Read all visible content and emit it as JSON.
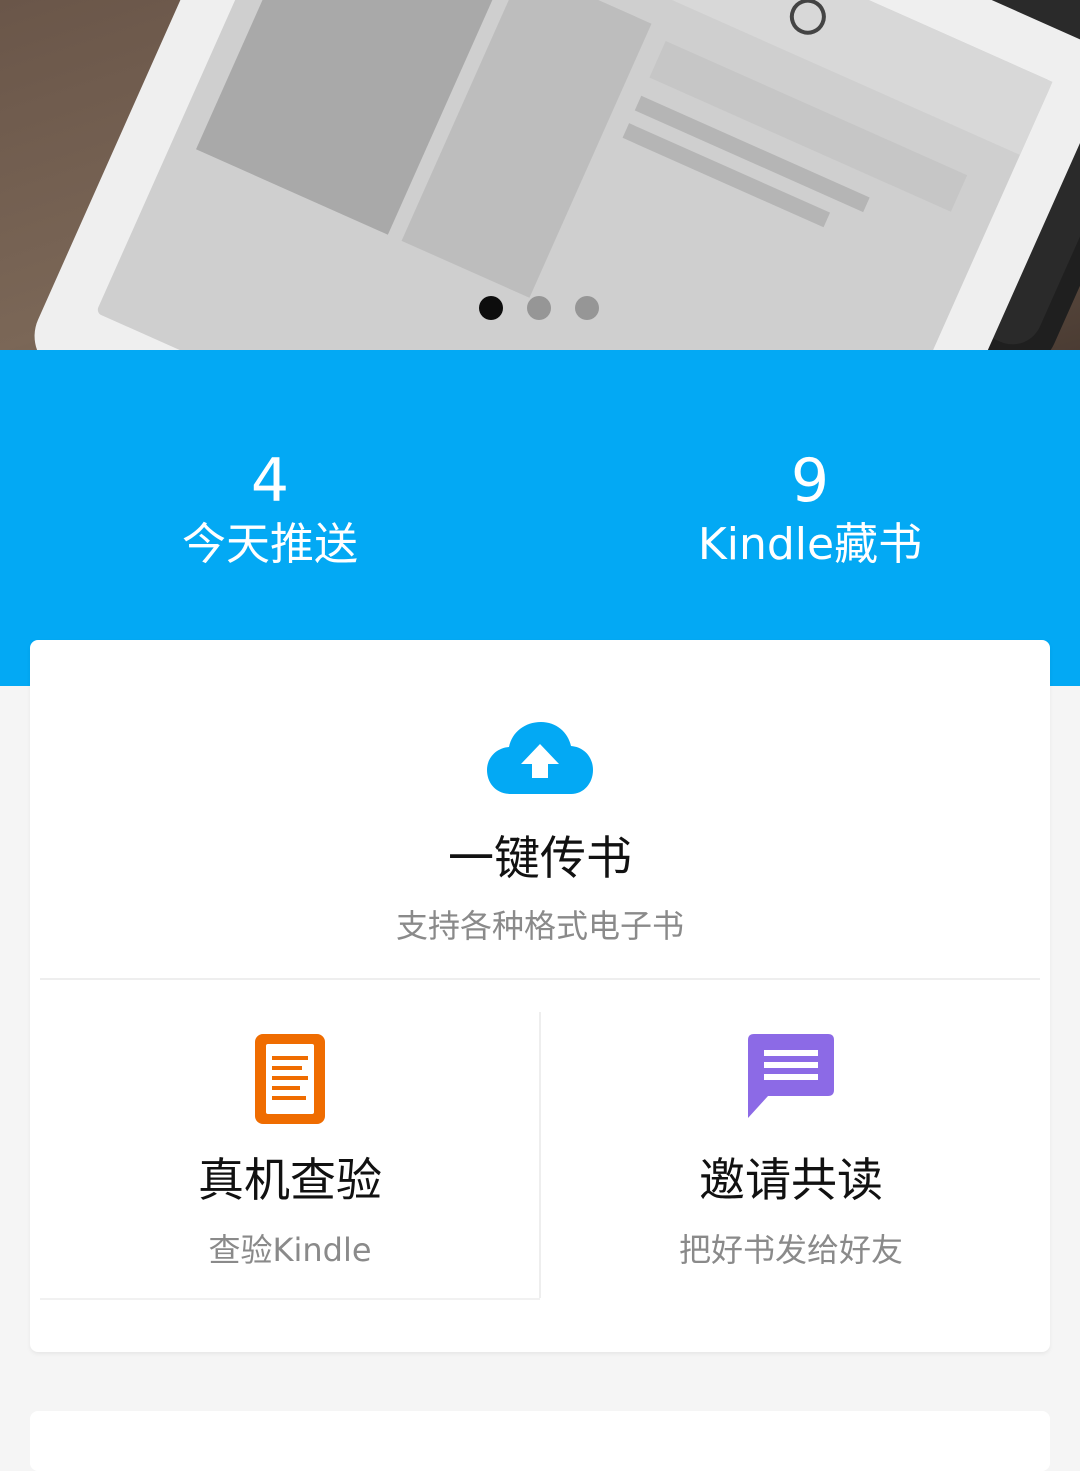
{
  "banner": {
    "slide_count": 3,
    "active_slide": 1
  },
  "stats": {
    "today_push": {
      "value": "4",
      "label": "今天推送"
    },
    "kindle_books": {
      "value": "9",
      "label": "Kindle藏书"
    }
  },
  "upload": {
    "title": "一键传书",
    "subtitle": "支持各种格式电子书",
    "icon": "cloud-upload-icon",
    "color": "#03a9f4"
  },
  "verify": {
    "title": "真机查验",
    "subtitle": "查验Kindle",
    "icon": "document-icon",
    "color": "#ef6c00"
  },
  "invite": {
    "title": "邀请共读",
    "subtitle": "把好书发给好友",
    "icon": "chat-bubble-icon",
    "color": "#8c6ae6"
  },
  "theme": {
    "accent": "#03a9f4",
    "background": "#f5f5f5"
  }
}
